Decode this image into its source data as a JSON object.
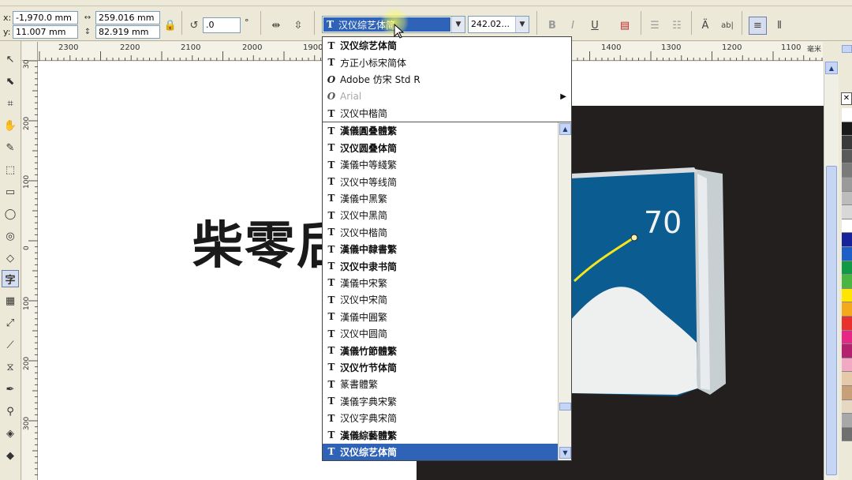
{
  "props": {
    "x_label": "x:",
    "y_label": "y:",
    "x_value": "-1,970.0 mm",
    "y_value": "11.007 mm",
    "width_value": "259.016 mm",
    "height_value": "82.919 mm",
    "rotation_value": ".0",
    "degree_symbol": "°",
    "font_name": "汉仪综艺体简",
    "font_size": "242.02..."
  },
  "ruler": {
    "h_labels": [
      "2300",
      "2200",
      "2100",
      "2000",
      "1900",
      "1400",
      "1300",
      "1200",
      "1100",
      "毫米"
    ],
    "v_labels": [
      "30",
      "200",
      "100",
      "0",
      "100",
      "200",
      "300"
    ]
  },
  "canvas": {
    "big_text": "柴零后",
    "badge_number": "70"
  },
  "dropdown": {
    "recent": [
      {
        "name": "汉仪综艺体简",
        "icon": "T",
        "bold": true,
        "dim": false
      },
      {
        "name": "方正小标宋简体",
        "icon": "T",
        "bold": false,
        "dim": false
      },
      {
        "name": "Adobe 仿宋 Std R",
        "icon": "O",
        "bold": false,
        "dim": false
      },
      {
        "name": "Arial",
        "icon": "O",
        "bold": false,
        "dim": true
      },
      {
        "name": "汉仪中楷简",
        "icon": "T",
        "bold": false,
        "dim": false
      }
    ],
    "fonts": [
      {
        "name": "漢儀圓叠體繁",
        "bold": true
      },
      {
        "name": "汉仪圆叠体简",
        "bold": true
      },
      {
        "name": "漢儀中等綫繁",
        "bold": false
      },
      {
        "name": "汉仪中等线简",
        "bold": false
      },
      {
        "name": "漢儀中黑繁",
        "bold": false
      },
      {
        "name": "汉仪中黑简",
        "bold": false
      },
      {
        "name": "汉仪中楷简",
        "bold": false
      },
      {
        "name": "漢儀中隸書繁",
        "bold": true
      },
      {
        "name": "汉仪中隶书简",
        "bold": true
      },
      {
        "name": "漢儀中宋繁",
        "bold": false
      },
      {
        "name": "汉仪中宋简",
        "bold": false
      },
      {
        "name": "漢儀中圓繁",
        "bold": false
      },
      {
        "name": "汉仪中圆简",
        "bold": false
      },
      {
        "name": "漢儀竹節體繁",
        "bold": true
      },
      {
        "name": "汉仪竹节体简",
        "bold": true
      },
      {
        "name": "篆書體繁",
        "bold": false
      },
      {
        "name": "漢儀字典宋繁",
        "bold": false
      },
      {
        "name": "汉仪字典宋简",
        "bold": false
      },
      {
        "name": "漢儀綜藝體繁",
        "bold": true
      },
      {
        "name": "汉仪综艺体简",
        "bold": true
      }
    ],
    "selected_index": 19
  },
  "colors": {
    "selection_blue": "#2f63b8",
    "canvas_dark": "#231f1f",
    "bag_blue": "#0a5c91",
    "palette": [
      "#ffffff",
      "#1a1a1a",
      "#3a3a3a",
      "#5a5a5a",
      "#7a7a7a",
      "#9a9a9a",
      "#bcbcbc",
      "#d8d8d8",
      "#ffffff",
      "#17239a",
      "#1d5fc8",
      "#0f9a45",
      "#49b642",
      "#ffe600",
      "#f3a91b",
      "#e8302d",
      "#e62786",
      "#b4216e",
      "#f2a9c3",
      "#e6c9a8",
      "#c8a078",
      "#e5d7c2",
      "#a8a8a8",
      "#6f6f6f"
    ]
  }
}
